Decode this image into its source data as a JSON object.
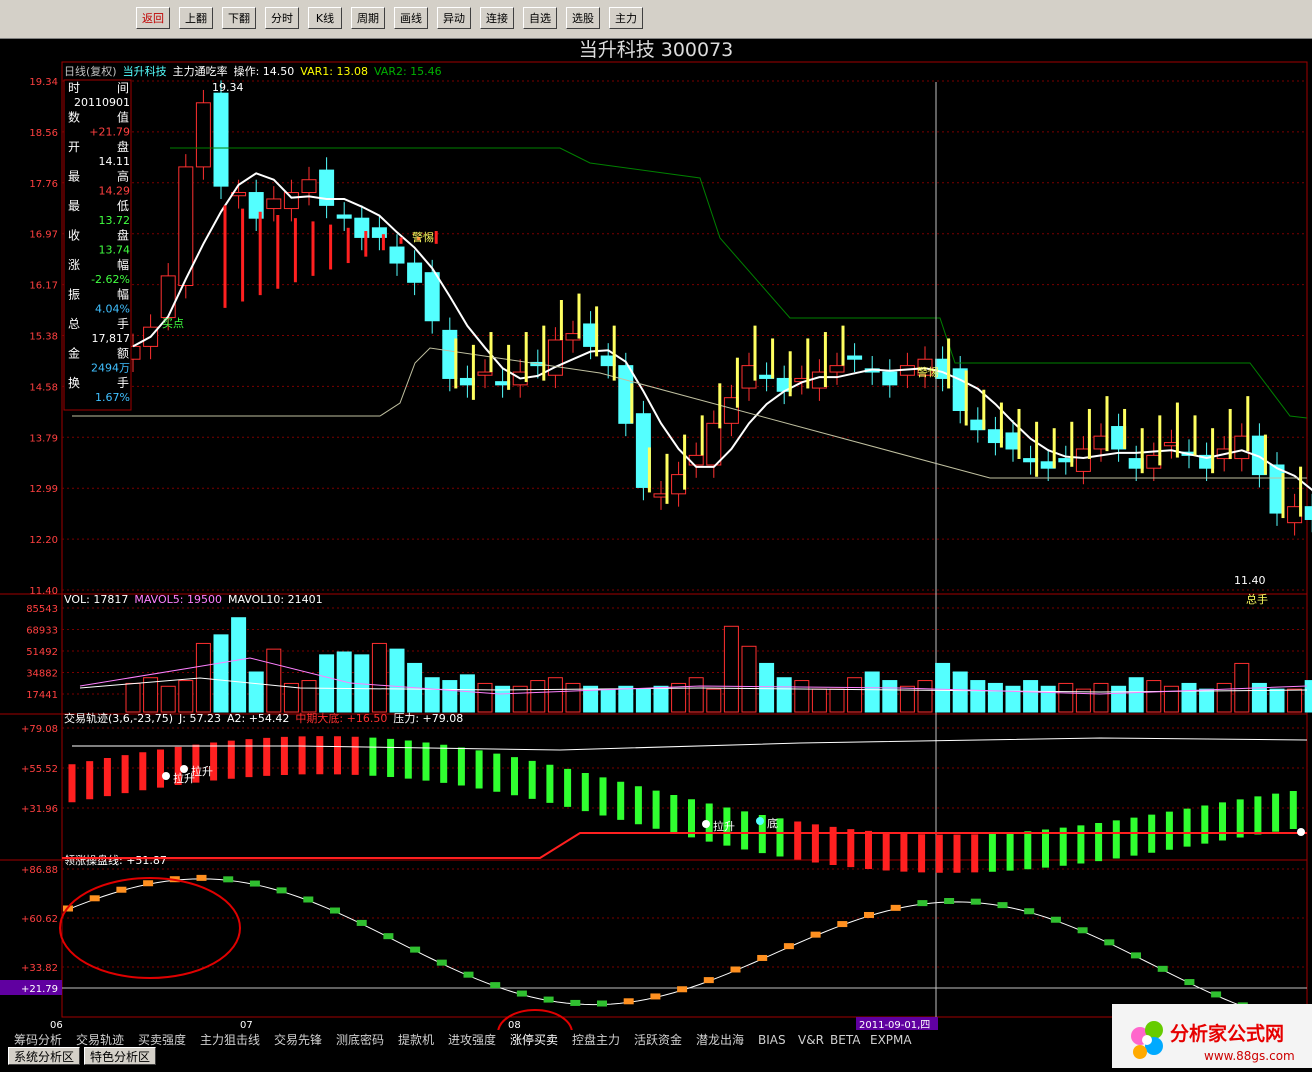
{
  "toolbar": {
    "buttons": [
      "返回",
      "上翻",
      "下翻",
      "分时",
      "K线",
      "周期",
      "画线",
      "异动",
      "连接",
      "自选",
      "选股",
      "主力"
    ]
  },
  "header": {
    "title": "当升科技  300073"
  },
  "price_panel": {
    "label_left": "日线(复权)",
    "label_stock": "当升科技",
    "label_indicator": "主力通吃率",
    "label_op": "操作: 14.50",
    "label_var1": "VAR1: 13.08",
    "label_var2": "VAR2: 15.46",
    "y_ticks": [
      "19.34",
      "18.56",
      "17.76",
      "16.97",
      "16.17",
      "15.38",
      "14.58",
      "13.79",
      "12.99",
      "12.20",
      "11.40"
    ],
    "high_label": "19.34",
    "low_label": "11.40",
    "warn_labels": [
      "警惕",
      "警惕"
    ],
    "buy_label": "买点",
    "total_hand": "总手",
    "info_box": [
      {
        "k1": "时",
        "k2": "间",
        "v": "20110901",
        "c": "#ffffff"
      },
      {
        "k1": "数",
        "k2": "值",
        "v": "+21.79",
        "c": "#ff4040"
      },
      {
        "k1": "开",
        "k2": "盘",
        "v": "14.11",
        "c": "#ffffff"
      },
      {
        "k1": "最",
        "k2": "高",
        "v": "14.29",
        "c": "#ff4040"
      },
      {
        "k1": "最",
        "k2": "低",
        "v": "13.72",
        "c": "#40ff40"
      },
      {
        "k1": "收",
        "k2": "盘",
        "v": "13.74",
        "c": "#40ff40"
      },
      {
        "k1": "涨",
        "k2": "幅",
        "v": "-2.62%",
        "c": "#40ff40"
      },
      {
        "k1": "振",
        "k2": "幅",
        "v": "4.04%",
        "c": "#40c0ff"
      },
      {
        "k1": "总",
        "k2": "手",
        "v": "17,817",
        "c": "#ffffff"
      },
      {
        "k1": "金",
        "k2": "额",
        "v": "2494万",
        "c": "#40c0ff"
      },
      {
        "k1": "换",
        "k2": "手",
        "v": "1.67%",
        "c": "#40c0ff"
      }
    ]
  },
  "vol_panel": {
    "label_vol": "VOL: 17817",
    "label_mavol5": "MAVOL5: 19500",
    "label_mavol10": "MAVOL10: 21401",
    "y_ticks": [
      "85543",
      "68933",
      "51492",
      "34882",
      "17441"
    ]
  },
  "trail_panel": {
    "label_name": "交易轨迹(3,6,-23,75)",
    "label_j": "J: 57.23",
    "label_a2": "A2: +54.42",
    "label_mid": "中期大底: +16.50",
    "label_press": "压力: +79.08",
    "y_ticks": [
      "+79.08",
      "+55.52",
      "+31.96"
    ],
    "marks": [
      "拉升",
      "拉升",
      "拉升",
      "底"
    ]
  },
  "lead_panel": {
    "label": "领涨操盘线: +51.87",
    "y_ticks": [
      "+86.88",
      "+60.62",
      "+33.82",
      "+21.79"
    ]
  },
  "x_axis": {
    "labels": [
      "06",
      "07",
      "08"
    ],
    "cursor_date": "2011-09-01,四"
  },
  "bottom_tabs": [
    "筹码分析",
    "交易轨迹",
    "买卖强度",
    "主力狙击线",
    "交易先锋",
    "测底密码",
    "提款机",
    "进攻强度",
    "涨停买卖",
    "控盘主力",
    "活跃资金",
    "潜龙出海",
    "BIAS",
    "V&R",
    "BETA",
    "EXPMA"
  ],
  "bottom_tabs2": [
    "系统分析区",
    "特色分析区"
  ],
  "logo": {
    "text": "分析家公式网",
    "url_text": "www.88gs.com"
  },
  "colors": {
    "up": "#ff3030",
    "down": "#54ffff",
    "grid": "#7a0000",
    "ma": "#ffffff",
    "yellow": "#ffff60",
    "green": "#008000"
  }
}
